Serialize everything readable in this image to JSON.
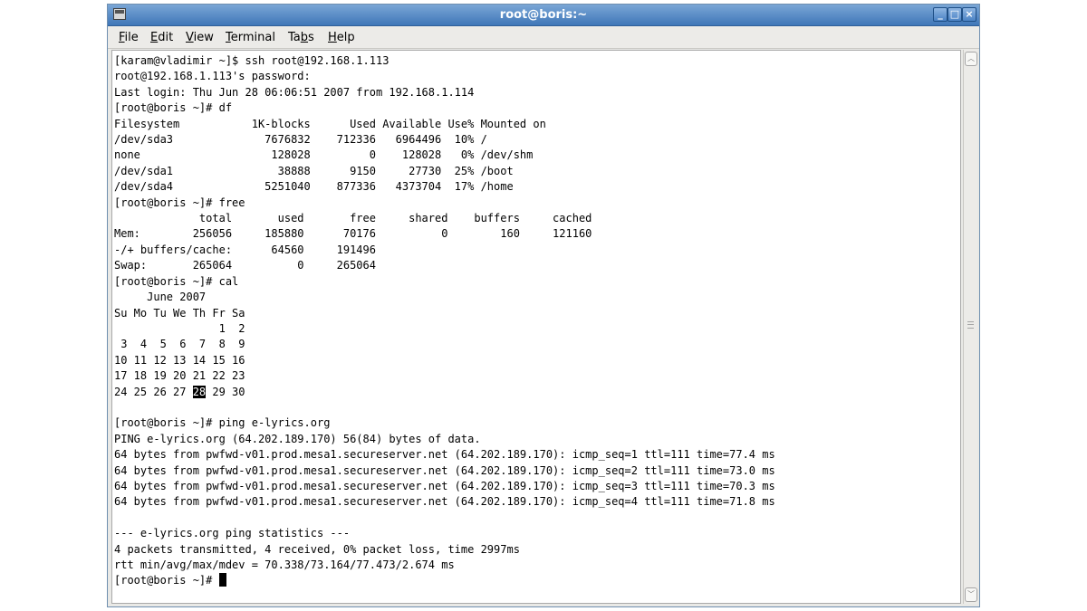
{
  "window": {
    "title": "root@boris:~",
    "controls": {
      "minimize": "_",
      "maximize": "□",
      "close": "×"
    }
  },
  "menu": {
    "file": {
      "mnemonic": "F",
      "rest": "ile"
    },
    "edit": {
      "mnemonic": "E",
      "rest": "dit"
    },
    "view": {
      "mnemonic": "V",
      "rest": "iew"
    },
    "terminal": {
      "mnemonic": "T",
      "rest": "erminal"
    },
    "tabs": {
      "pre": "Ta",
      "mnemonic": "b",
      "rest": "s"
    },
    "help": {
      "mnemonic": "H",
      "rest": "elp"
    }
  },
  "terminal": {
    "before_highlight": "[karam@vladimir ~]$ ssh root@192.168.1.113\nroot@192.168.1.113's password:\nLast login: Thu Jun 28 06:06:51 2007 from 192.168.1.114\n[root@boris ~]# df\nFilesystem           1K-blocks      Used Available Use% Mounted on\n/dev/sda3              7676832    712336   6964496  10% /\nnone                    128028         0    128028   0% /dev/shm\n/dev/sda1                38888      9150     27730  25% /boot\n/dev/sda4              5251040    877336   4373704  17% /home\n[root@boris ~]# free\n             total       used       free     shared    buffers     cached\nMem:        256056     185880      70176          0        160     121160\n-/+ buffers/cache:      64560     191496\nSwap:       265064          0     265064\n[root@boris ~]# cal\n     June 2007\nSu Mo Tu We Th Fr Sa\n                1  2\n 3  4  5  6  7  8  9\n10 11 12 13 14 15 16\n17 18 19 20 21 22 23\n24 25 26 27 ",
    "highlight": "28",
    "after_highlight": " 29 30\n\n[root@boris ~]# ping e-lyrics.org\nPING e-lyrics.org (64.202.189.170) 56(84) bytes of data.\n64 bytes from pwfwd-v01.prod.mesa1.secureserver.net (64.202.189.170): icmp_seq=1 ttl=111 time=77.4 ms\n64 bytes from pwfwd-v01.prod.mesa1.secureserver.net (64.202.189.170): icmp_seq=2 ttl=111 time=73.0 ms\n64 bytes from pwfwd-v01.prod.mesa1.secureserver.net (64.202.189.170): icmp_seq=3 ttl=111 time=70.3 ms\n64 bytes from pwfwd-v01.prod.mesa1.secureserver.net (64.202.189.170): icmp_seq=4 ttl=111 time=71.8 ms\n\n--- e-lyrics.org ping statistics ---\n4 packets transmitted, 4 received, 0% packet loss, time 2997ms\nrtt min/avg/max/mdev = 70.338/73.164/77.473/2.674 ms\n[root@boris ~]# "
  },
  "scrollbar": {
    "up_arrow": "︿",
    "down_arrow": "﹀"
  }
}
